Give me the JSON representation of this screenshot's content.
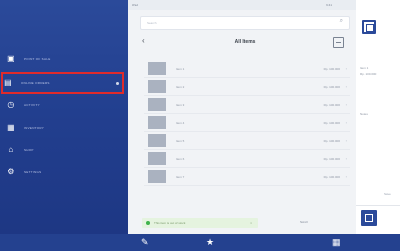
{
  "sidebar": {
    "items": [
      {
        "label": "POINT OF SALE",
        "icon": "register-icon",
        "active": false
      },
      {
        "label": "ONLINE ORDERS",
        "icon": "orders-icon",
        "active": true
      },
      {
        "label": "ACTIVITY",
        "icon": "clock-icon",
        "active": false
      },
      {
        "label": "INVENTORY",
        "icon": "box-icon",
        "active": false
      },
      {
        "label": "SHOP",
        "icon": "shop-icon",
        "active": false
      },
      {
        "label": "SETTINGS",
        "icon": "gear-icon",
        "active": false
      }
    ]
  },
  "topbar": {
    "left": "iPad",
    "right": "9:41"
  },
  "search": {
    "placeholder": "Search"
  },
  "list": {
    "title": "All Items",
    "items": [
      {
        "name": "Item 1",
        "price": "Rp. 100.000"
      },
      {
        "name": "Item 2",
        "price": "Rp. 100.000"
      },
      {
        "name": "Item 3",
        "price": "Rp. 100.000"
      },
      {
        "name": "Item 4",
        "price": "Rp. 100.000"
      },
      {
        "name": "Item 5",
        "price": "Rp. 100.000"
      },
      {
        "name": "Item 6",
        "price": "Rp. 100.000"
      },
      {
        "name": "Item 7",
        "price": "Rp. 100.000"
      }
    ]
  },
  "notice": {
    "text": "This item is out of stock",
    "close": "×"
  },
  "footer": {
    "right": "Scroll"
  },
  "right_panel": {
    "line1": "Item 1",
    "line2": "Rp. 100.000",
    "line3": "Notes",
    "button": "Save"
  },
  "colors": {
    "sidebar": "#2b4a9a",
    "bottom_bar": "#24418f",
    "active_outline": "#e02b2b",
    "notice_bg": "#e5f3df"
  }
}
